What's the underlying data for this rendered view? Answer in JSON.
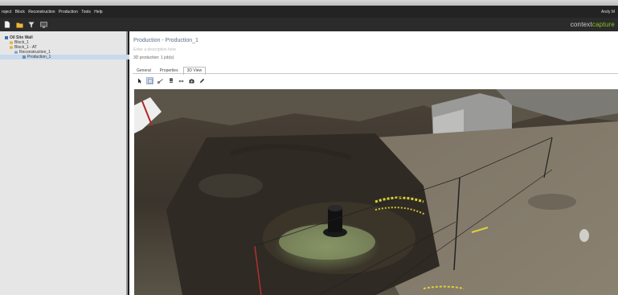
{
  "menu": {
    "items": [
      "roject",
      "Block",
      "Reconstruction",
      "Production",
      "Tools",
      "Help"
    ],
    "user": "Andy M"
  },
  "toolbar": {
    "icons": [
      "new-icon",
      "open-folder-icon",
      "filter-icon",
      "monitor-icon"
    ]
  },
  "brand": {
    "prefix": "context",
    "suffix": "capture"
  },
  "tree": {
    "items": [
      {
        "label": "Oil Site Wall",
        "icon": "project-icon",
        "level": 0
      },
      {
        "label": "Block_1",
        "icon": "folder-icon",
        "level": 1
      },
      {
        "label": "Block_1 - AT",
        "icon": "folder-icon",
        "level": 1
      },
      {
        "label": "Reconstruction_1",
        "icon": "folder-icon",
        "level": 2
      },
      {
        "label": "Production_1",
        "icon": "production-icon",
        "level": 3
      }
    ]
  },
  "production": {
    "title": "Production - Production_1",
    "description": "Enter a description here",
    "status": "3D production: 1 job(s)",
    "tabs": [
      "General",
      "Properties",
      "3D View"
    ],
    "active_tab": "3D View"
  },
  "view_tools": [
    "pointer-icon",
    "select-icon",
    "measure-icon",
    "layers-icon",
    "move-icon",
    "camera-icon",
    "pen-icon"
  ],
  "colors": {
    "menubar": "#232323",
    "toolbar": "#2b2b2b",
    "brand_accent": "#8fc31f",
    "title": "#5a6f8a",
    "selection": "#c9d9ee"
  }
}
